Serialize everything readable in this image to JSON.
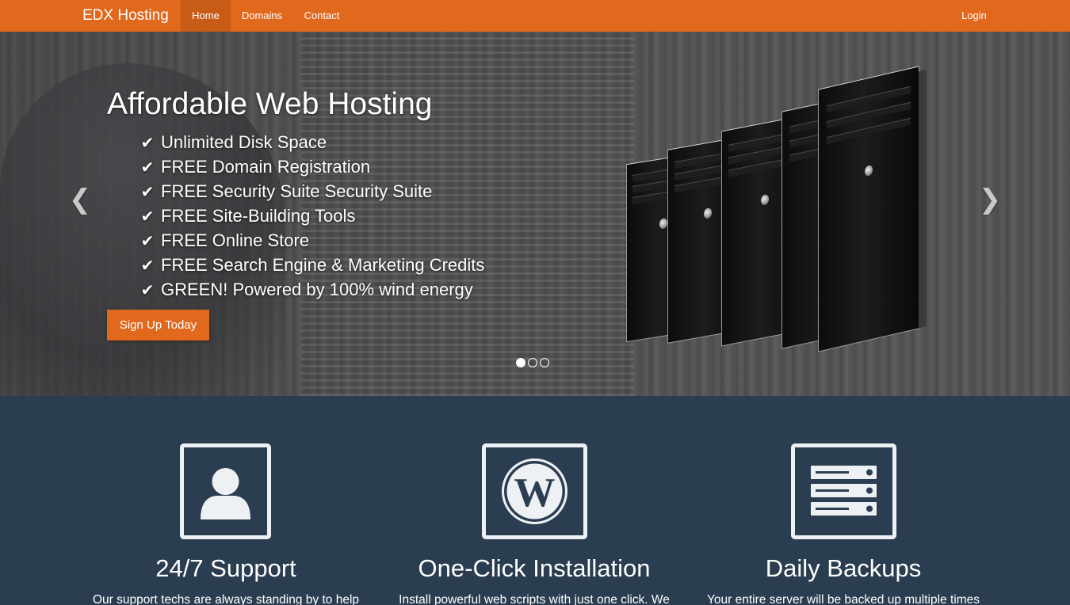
{
  "nav": {
    "brand": "EDX Hosting",
    "items": [
      {
        "label": "Home",
        "active": true
      },
      {
        "label": "Domains",
        "active": false
      },
      {
        "label": "Contact",
        "active": false
      }
    ],
    "login": "Login"
  },
  "hero": {
    "title": "Affordable Web Hosting",
    "features": [
      "Unlimited Disk Space",
      "FREE Domain Registration",
      "FREE Security Suite Security Suite",
      "FREE Site-Building Tools",
      "FREE Online Store",
      "FREE Search Engine & Marketing Credits",
      "GREEN! Powered by 100% wind energy"
    ],
    "check_icon": "check-icon",
    "signup_label": "Sign Up Today",
    "prev_icon": "chevron-left-icon",
    "next_icon": "chevron-right-icon",
    "slide_count": 3,
    "active_slide": 1
  },
  "services": [
    {
      "icon": "user-icon",
      "title": "24/7 Support",
      "text": "Our support techs are always standing by to help"
    },
    {
      "icon": "wordpress-icon",
      "title": "One-Click Installation",
      "text": "Install powerful web scripts with just one click. We"
    },
    {
      "icon": "server-icon",
      "title": "Daily Backups",
      "text": "Your entire server will be backed up multiple times"
    }
  ],
  "colors": {
    "accent": "#e0691d",
    "accent_dark": "#c85b15",
    "section_bg": "#2b3e51",
    "text": "#ffffff"
  }
}
